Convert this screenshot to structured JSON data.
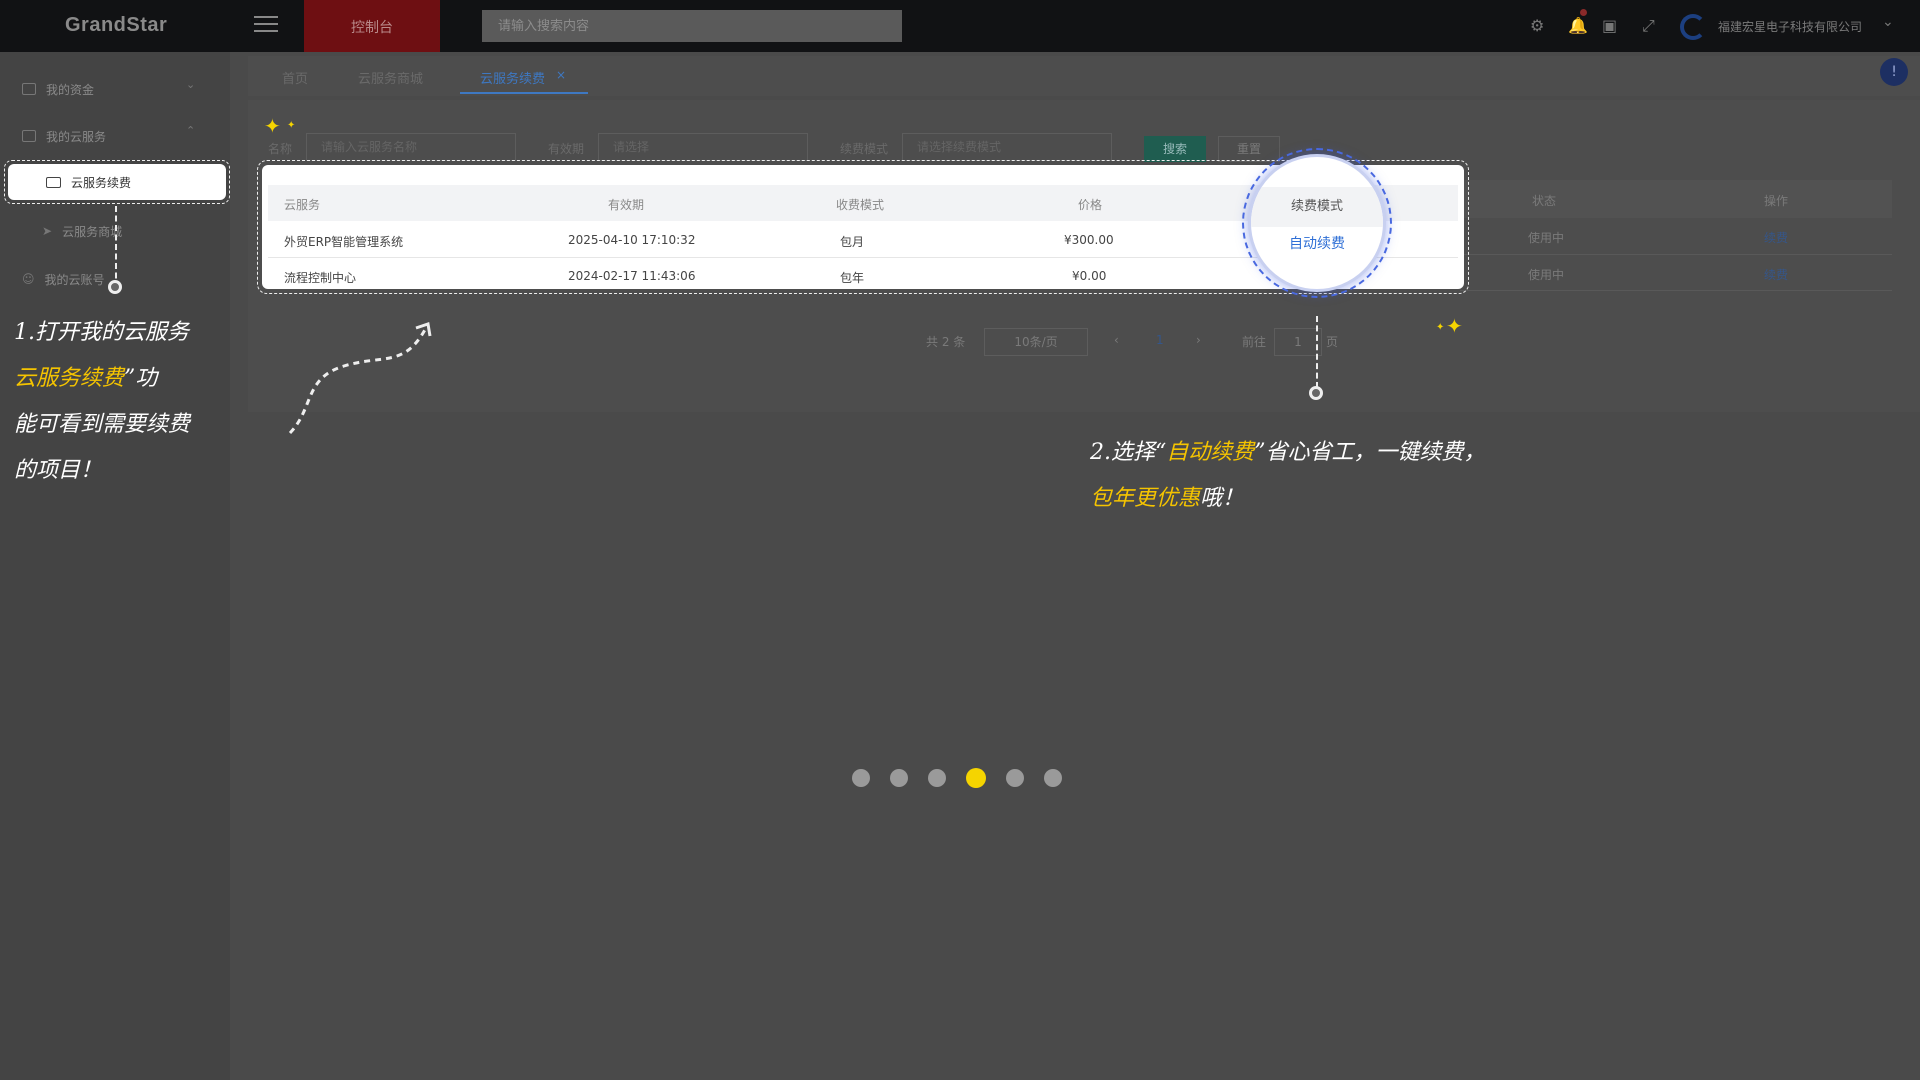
{
  "topbar": {
    "logo": "GrandStar",
    "console_tab": "控制台",
    "search_placeholder": "请输入搜索内容",
    "company_name": "福建宏星电子科技有限公司"
  },
  "sidebar": {
    "items": [
      {
        "label": "我的资金"
      },
      {
        "label": "我的云服务"
      },
      {
        "label": "云服务续费"
      },
      {
        "label": "云服务商城"
      },
      {
        "label": "我的云账号"
      }
    ]
  },
  "tabs": [
    {
      "label": "首页"
    },
    {
      "label": "云服务商城"
    },
    {
      "label": "云服务续费"
    }
  ],
  "filters": {
    "name_label": "名称",
    "name_placeholder": "请输入云服务名称",
    "validity_label": "有效期",
    "validity_placeholder": "请选择",
    "renew_mode_label": "续费模式",
    "renew_mode_placeholder": "请选择续费模式",
    "search_button": "搜索",
    "reset_button": "重置"
  },
  "table": {
    "headers": [
      "云服务",
      "有效期",
      "收费模式",
      "价格",
      "状态",
      "操作"
    ],
    "rows": [
      {
        "service": "外贸ERP智能管理系统",
        "validity": "2025-04-10 17:10:32",
        "charge_mode": "包月",
        "price": "¥300.00",
        "status": "使用中",
        "action": "续费"
      },
      {
        "service": "流程控制中心",
        "validity": "2024-02-17 11:43:06",
        "charge_mode": "包年",
        "price": "¥0.00",
        "status": "使用中",
        "action": "续费"
      }
    ]
  },
  "magnifier": {
    "header": "续费模式",
    "value": "自动续费"
  },
  "pagination": {
    "total": "共 2 条",
    "page_size": "10条/页",
    "current_page": "1",
    "goto_label": "前往",
    "goto_value": "1",
    "page_unit": "页"
  },
  "annotations": {
    "step1_line1": "1.打开我的云服务",
    "step1_line2_hl": "云服务续费",
    "step1_line2_rest": "”功",
    "step1_line3": "能可看到需要续费",
    "step1_line4": "的项目！",
    "step2_line1_a": "2.选择“",
    "step2_line1_hl": "自动续费",
    "step2_line1_b": "”省心省工，一键续费，",
    "step2_line2_hl": "包年更优惠",
    "step2_line2_rest": "哦！"
  },
  "carousel": {
    "count": 6,
    "active_index": 3
  },
  "colors": {
    "accent": "#f5d400",
    "link": "#2f6fd6",
    "console": "#6e0f12"
  }
}
